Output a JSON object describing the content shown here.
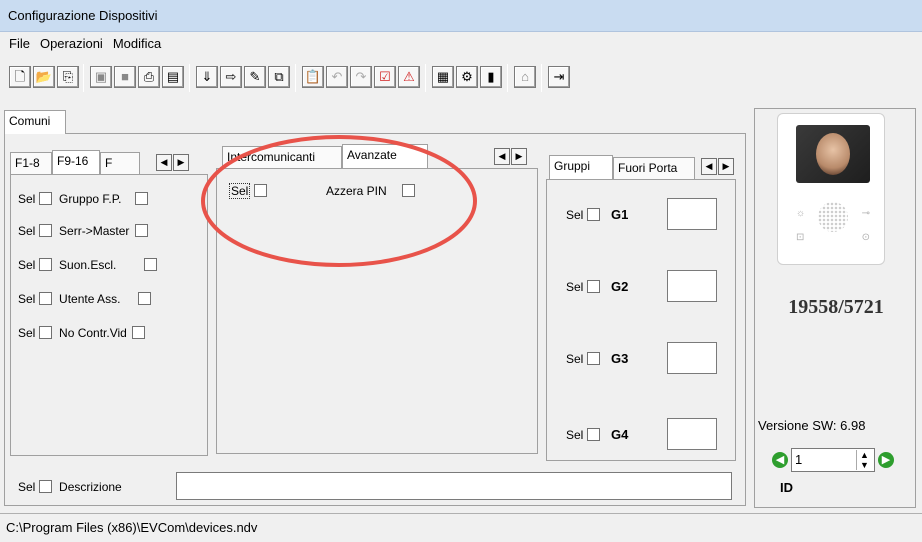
{
  "window": {
    "title": "Configurazione Dispositivi"
  },
  "menu": [
    "File",
    "Operazioni",
    "Modifica"
  ],
  "toolbar": {
    "icons": [
      "new-file-icon",
      "open-folder-icon",
      "import-icon",
      "save-icon",
      "save-all-icon",
      "print-icon",
      "print-preview-icon",
      "sort-icon",
      "export-icon",
      "edit-icon",
      "copy-icon",
      "paste-icon",
      "undo-icon",
      "redo-icon",
      "check-icon",
      "alert-icon",
      "calendar-icon",
      "settings-icon",
      "book-icon",
      "tag-icon",
      "exit-icon"
    ]
  },
  "top_tab": "Comuni",
  "left_panel": {
    "tabs": [
      "F1-8",
      "F9-16",
      "F"
    ],
    "sel_label": "Sel",
    "rows": [
      "Gruppo F.P.",
      "Serr->Master",
      "Suon.Escl.",
      "Utente Ass.",
      "No Contr.Vid"
    ]
  },
  "mid_panel": {
    "tabs": [
      "Intercomunicanti",
      "Avanzate"
    ],
    "sel_label": "Sel",
    "azzera_pin": "Azzera PIN"
  },
  "right_panel": {
    "tabs": [
      "Gruppi",
      "Fuori Porta"
    ],
    "sel_label": "Sel",
    "groups": [
      "G1",
      "G2",
      "G3",
      "G4"
    ]
  },
  "description": {
    "sel_label": "Sel",
    "label": "Descrizione",
    "value": ""
  },
  "device": {
    "model": "19558/5721",
    "version": "Versione SW: 6.98",
    "id_value": "1",
    "id_label": "ID"
  },
  "status": {
    "path": "C:\\Program Files (x86)\\EVCom\\devices.ndv"
  },
  "colors": {
    "highlight_ellipse": "#e8534a",
    "titlebar": "#c9dcf1",
    "nav_green": "#2e9e2e"
  }
}
